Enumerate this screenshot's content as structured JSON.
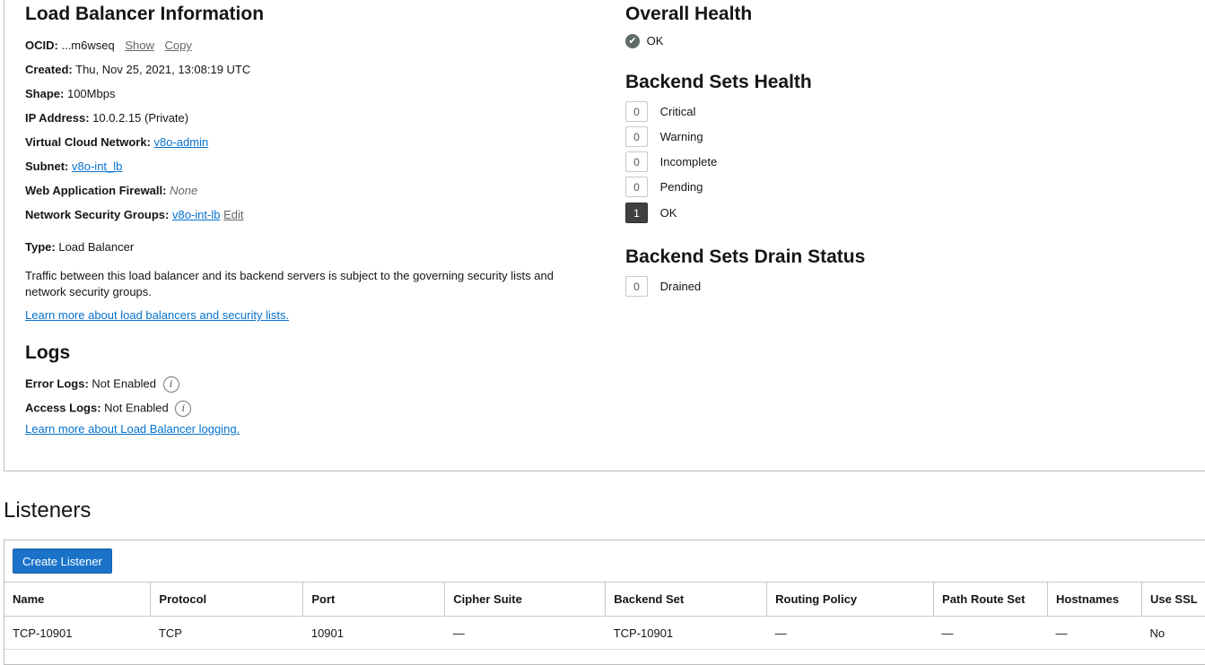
{
  "lb_info": {
    "title": "Load Balancer Information",
    "ocid_label": "OCID:",
    "ocid_value": "...m6wseq",
    "show": "Show",
    "copy": "Copy",
    "created_label": "Created:",
    "created_value": "Thu, Nov 25, 2021, 13:08:19 UTC",
    "shape_label": "Shape:",
    "shape_value": "100Mbps",
    "ip_label": "IP Address:",
    "ip_value": "10.0.2.15 (Private)",
    "vcn_label": "Virtual Cloud Network:",
    "vcn_value": "v8o-admin",
    "subnet_label": "Subnet:",
    "subnet_value": "v8o-int_lb",
    "waf_label": "Web Application Firewall:",
    "waf_value": "None",
    "nsg_label": "Network Security Groups:",
    "nsg_value": "v8o-int-lb",
    "nsg_edit": "Edit",
    "type_label": "Type:",
    "type_value": "Load Balancer",
    "traffic_note": "Traffic between this load balancer and its backend servers is subject to the governing security lists and network security groups.",
    "learn_more": "Learn more about load balancers and security lists."
  },
  "logs": {
    "title": "Logs",
    "error_label": "Error Logs:",
    "error_value": "Not Enabled",
    "access_label": "Access Logs:",
    "access_value": "Not Enabled",
    "learn_more": "Learn more about Load Balancer logging."
  },
  "overall_health": {
    "title": "Overall Health",
    "status": "OK"
  },
  "backend_sets_health": {
    "title": "Backend Sets Health",
    "items": [
      {
        "count": "0",
        "label": "Critical"
      },
      {
        "count": "0",
        "label": "Warning"
      },
      {
        "count": "0",
        "label": "Incomplete"
      },
      {
        "count": "0",
        "label": "Pending"
      },
      {
        "count": "1",
        "label": "OK"
      }
    ]
  },
  "drain_status": {
    "title": "Backend Sets Drain Status",
    "items": [
      {
        "count": "0",
        "label": "Drained"
      }
    ]
  },
  "listeners": {
    "title": "Listeners",
    "create_button": "Create Listener",
    "columns": [
      "Name",
      "Protocol",
      "Port",
      "Cipher Suite",
      "Backend Set",
      "Routing Policy",
      "Path Route Set",
      "Hostnames",
      "Use SSL"
    ],
    "rows": [
      [
        "TCP-10901",
        "TCP",
        "10901",
        "—",
        "TCP-10901",
        "—",
        "—",
        "—",
        "No"
      ]
    ]
  },
  "colors": {
    "link": "#0572ce",
    "button": "#1a73c9",
    "ok_badge": "#404040"
  },
  "icons": {
    "info": "info-icon",
    "ok": "check-circle-icon"
  }
}
